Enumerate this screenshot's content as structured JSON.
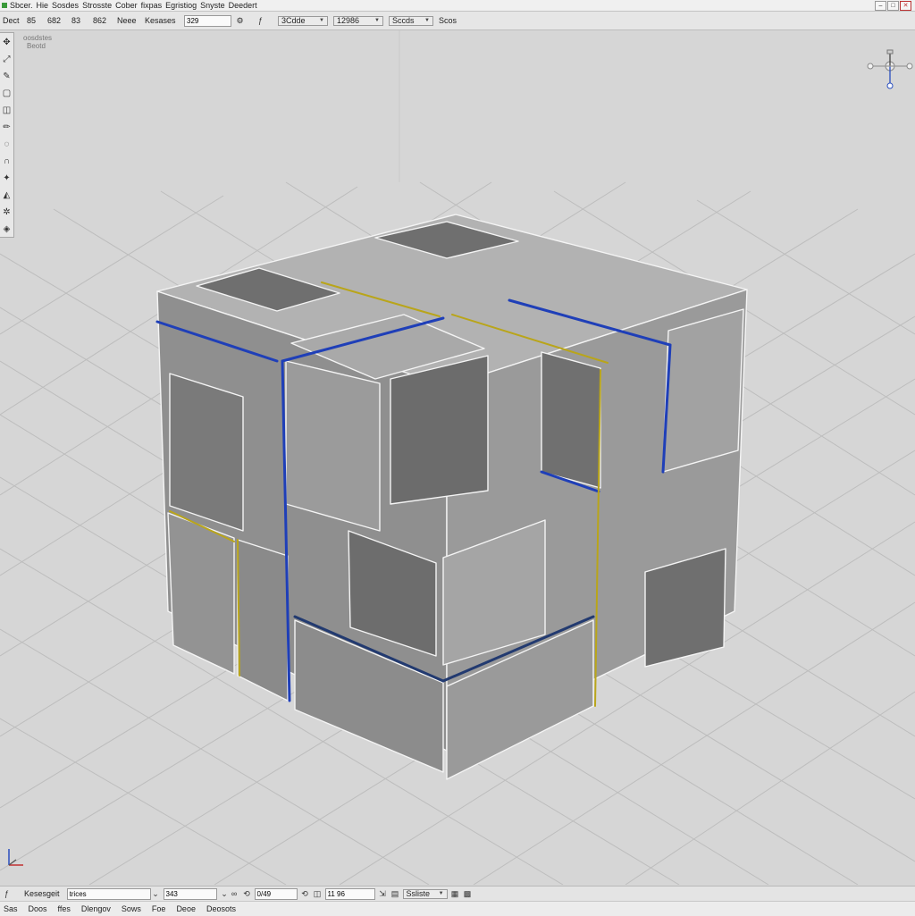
{
  "menubar": {
    "items": [
      "Sbcer.",
      "Hie",
      "Sosdes",
      "Strosste",
      "Cober",
      "fixpas",
      "Egristiog",
      "Snyste",
      "Deedert"
    ]
  },
  "toolbar": {
    "label_1": "Dect",
    "label_2": "85",
    "label_3": "682",
    "label_4": "83",
    "label_5": "862",
    "label_6": "Neee",
    "label_7": "Kesases",
    "input_1": "329",
    "select_1": "3Cdde",
    "select_2": "12986",
    "select_3": "Sccds",
    "label_8": "Scos"
  },
  "toolpanel": {
    "icons": [
      "move-icon",
      "scale-icon",
      "brush-icon",
      "frame-icon",
      "cube-icon",
      "pencil-icon",
      "lasso-icon",
      "magnet-icon",
      "paint-icon",
      "bucket-icon",
      "gear-icon",
      "drop-icon"
    ]
  },
  "viewport": {
    "label_line1": "oosdstes",
    "label_line2": "Beotd",
    "colors": {
      "background": "#d6d6d6",
      "grid": "#bdbdbd",
      "face": "#9e9e9e",
      "edge_selected_blue": "#1f3fb8",
      "edge_selected_yellow": "#b9a51a"
    }
  },
  "statusbar": {
    "label_1": "Kesesgeit",
    "input_1": "trices",
    "input_2": "343",
    "input_3": "0/49",
    "input_4": "11 96",
    "select_1": "Ssliste"
  },
  "bottombar": {
    "items": [
      "Sas",
      "Doos",
      "ffes",
      "Dlengov",
      "Sows",
      "Foe",
      "Deoe",
      "Deosots"
    ]
  }
}
